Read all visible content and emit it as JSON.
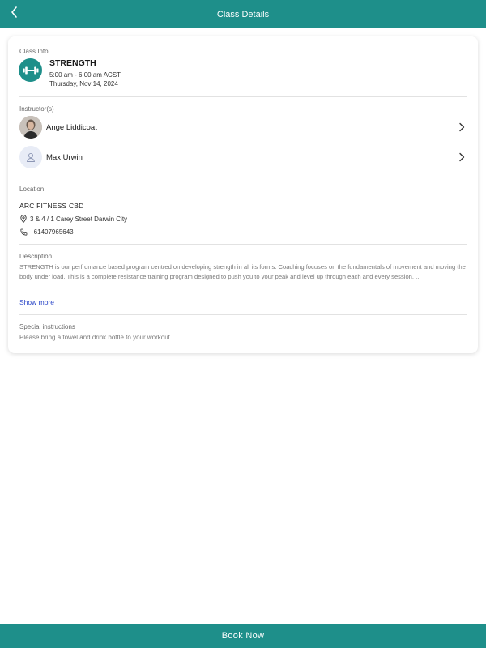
{
  "header": {
    "title": "Class Details",
    "back_icon": "chevron-left-icon"
  },
  "class_info": {
    "label": "Class Info",
    "icon": "dumbbell-icon",
    "name": "STRENGTH",
    "time": "5:00 am - 6:00 am ACST",
    "date": "Thursday, Nov 14, 2024"
  },
  "instructors": {
    "label": "Instructor(s)",
    "items": [
      {
        "name": "Ange Liddicoat",
        "avatar": "photo"
      },
      {
        "name": "Max Urwin",
        "avatar": "placeholder-person-icon"
      }
    ]
  },
  "location": {
    "label": "Location",
    "name": "ARC FITNESS CBD",
    "address": "3 & 4 / 1 Carey Street Darwin City",
    "phone": "+61407965643"
  },
  "description": {
    "label": "Description",
    "text": "STRENGTH is our perfromance based program centred on developing strength in all its forms. Coaching focuses on the fundamentals of movement and moving the body under load. This is a complete resistance training program designed to push you to your peak and level up through each and every session. ...",
    "show_more": "Show more"
  },
  "special_instructions": {
    "label": "Special instructions",
    "text": "Please bring a towel and drink bottle to your workout."
  },
  "footer": {
    "book_label": "Book Now"
  },
  "colors": {
    "primary": "#1e8f8a",
    "link": "#2a46c8"
  }
}
